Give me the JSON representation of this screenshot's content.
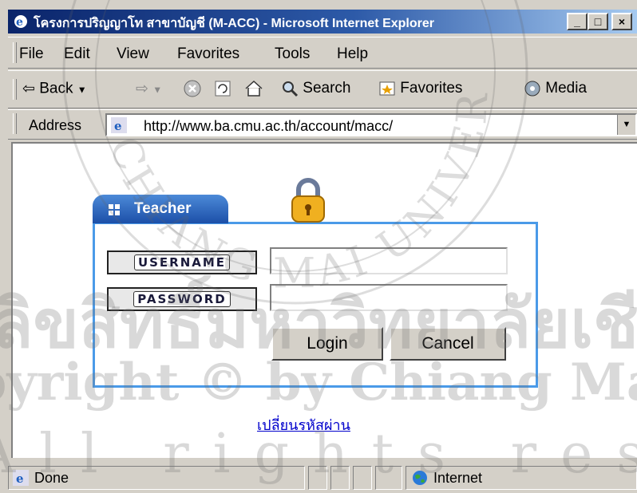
{
  "window": {
    "title": "โครงการปริญญาโท สาขาบัญชี (M-ACC) - Microsoft Internet Explorer",
    "controls": [
      "_",
      "□",
      "×"
    ]
  },
  "menu": [
    "File",
    "Edit",
    "View",
    "Favorites",
    "Tools",
    "Help"
  ],
  "toolbar": {
    "back": "Back",
    "search": "Search",
    "favorites": "Favorites",
    "media": "Media"
  },
  "address": {
    "label": "Address",
    "url": "http://www.ba.cmu.ac.th/account/macc/"
  },
  "login": {
    "panel_title": "Teacher",
    "username_label": "USERNAME",
    "password_label": "PASSWORD",
    "username_value": "",
    "password_value": "",
    "login_button": "Login",
    "cancel_button": "Cancel",
    "change_password_link": "เปลี่ยนรหัสผ่าน"
  },
  "status": {
    "text": "Done",
    "zone": "Internet"
  },
  "watermark": {
    "arc": "CHIANG MAI UNIVERSITY",
    "line1": "ลิขสิทธิ์มหาวิทยาลัยเชียงใหม่",
    "line2": "Copyright © by Chiang Mai University",
    "line3": "All rights reserved"
  },
  "colors": {
    "titlebar": "#0a246a",
    "panel_border": "#4a9ae8",
    "link": "#0000cc"
  }
}
